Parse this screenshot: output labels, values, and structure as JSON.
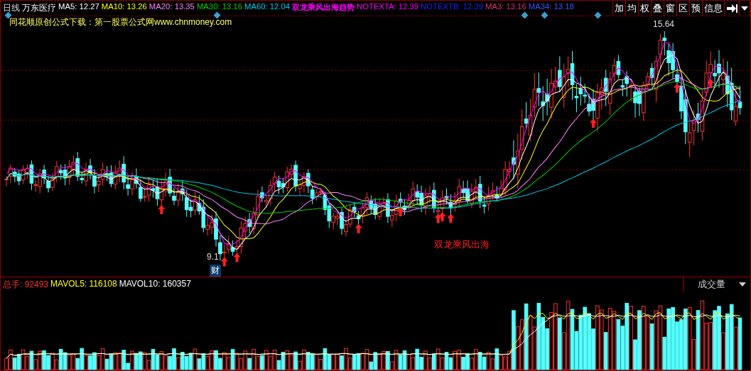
{
  "header": {
    "period": "日线",
    "stock": "万东医疗",
    "indicators": [
      {
        "name": "MA5:",
        "value": "12.27",
        "color": "#ffffff"
      },
      {
        "name": "MA10:",
        "value": "13.26",
        "color": "#ffff00"
      },
      {
        "name": "MA20:",
        "value": "13.35",
        "color": "#ff80ff"
      },
      {
        "name": "MA30:",
        "value": "13.16",
        "color": "#00d000"
      },
      {
        "name": "MA60:",
        "value": "12.04",
        "color": "#00c8e8"
      },
      {
        "name": "双龙乘风出海趋势",
        "color": "#ff00ff"
      },
      {
        "name": "NOTEXTA:",
        "value": "12.39",
        "color": "#ff00ff"
      },
      {
        "name": "NOTEXTB:",
        "value": "12.39",
        "color": "#2020ff"
      },
      {
        "name": "MA3:",
        "value": "13.16",
        "color": "#e03070"
      },
      {
        "name": "MA34:",
        "value": "13.18",
        "color": "#4050ff"
      }
    ]
  },
  "toolbar": [
    "加",
    "均",
    "权",
    "叠",
    "窗",
    "区",
    "预",
    "信息"
  ],
  "description": "同花顺原创公式下载：第一股票公式网www.chnmoney.com",
  "chart": {
    "high_label": "15.64",
    "low_label": "9.1",
    "badge": "财",
    "signal": "双龙乘风出海"
  },
  "volume": {
    "indicators": [
      {
        "name": "总手:",
        "value": "92493",
        "color": "#ff3030"
      },
      {
        "name": "MAVOL5:",
        "value": "116108",
        "color": "#ffff00"
      },
      {
        "name": "MAVOL10:",
        "value": "160357",
        "color": "#ffffff"
      }
    ],
    "selector": "成交量"
  }
}
